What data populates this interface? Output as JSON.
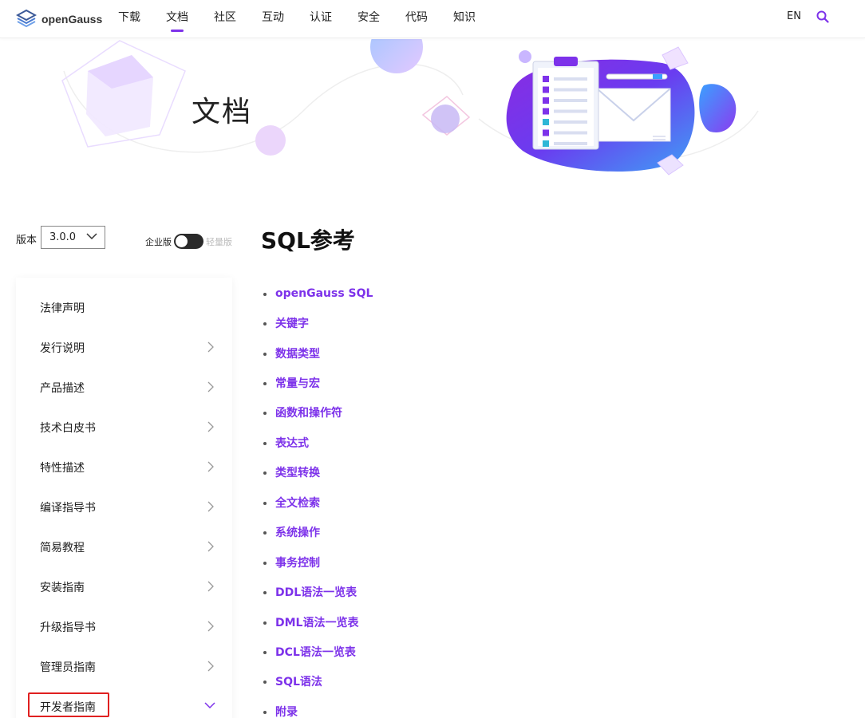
{
  "header": {
    "logo_text": "openGauss",
    "nav": [
      "下载",
      "文档",
      "社区",
      "互动",
      "认证",
      "安全",
      "代码",
      "知识"
    ],
    "active_nav": "文档",
    "lang": "EN"
  },
  "banner": {
    "title": "文档"
  },
  "sidebar": {
    "version_label": "版本",
    "version_value": "3.0.0",
    "edition_enterprise": "企业版",
    "edition_lite": "轻量版",
    "items": [
      {
        "label": "法律声明",
        "has_children": false
      },
      {
        "label": "发行说明",
        "has_children": true
      },
      {
        "label": "产品描述",
        "has_children": true
      },
      {
        "label": "技术白皮书",
        "has_children": true
      },
      {
        "label": "特性描述",
        "has_children": true
      },
      {
        "label": "编译指导书",
        "has_children": true
      },
      {
        "label": "简易教程",
        "has_children": true
      },
      {
        "label": "安装指南",
        "has_children": true
      },
      {
        "label": "升级指导书",
        "has_children": true
      },
      {
        "label": "管理员指南",
        "has_children": true
      },
      {
        "label": "开发者指南",
        "has_children": true,
        "expanded": true
      }
    ]
  },
  "main": {
    "title": "SQL参考",
    "links": [
      "openGauss SQL",
      "关键字",
      "数据类型",
      "常量与宏",
      "函数和操作符",
      "表达式",
      "类型转换",
      "全文检索",
      "系统操作",
      "事务控制",
      "DDL语法一览表",
      "DML语法一览表",
      "DCL语法一览表",
      "SQL语法",
      "附录"
    ]
  },
  "colors": {
    "accent": "#7d32ea",
    "highlight": "#e02020"
  }
}
